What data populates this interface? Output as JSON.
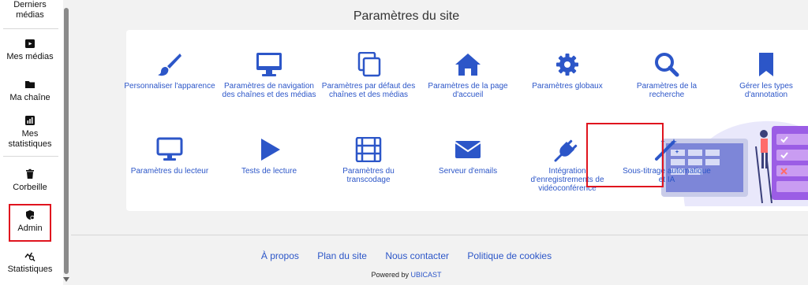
{
  "sidebar": {
    "items": [
      {
        "label": "Derniers médias",
        "icon": "clock-icon"
      },
      {
        "label": "Mes médias",
        "icon": "media-icon"
      },
      {
        "label": "Ma chaîne",
        "icon": "folder-icon"
      },
      {
        "label": "Mes statistiques",
        "icon": "stats-icon"
      },
      {
        "label": "Corbeille",
        "icon": "trash-icon"
      },
      {
        "label": "Admin",
        "icon": "admin-shield-icon"
      },
      {
        "label": "Statistiques",
        "icon": "analytics-icon"
      }
    ]
  },
  "page": {
    "title": "Paramètres du site"
  },
  "settings": {
    "row1": [
      {
        "label": "Personnaliser l'apparence",
        "icon": "paintbrush-icon"
      },
      {
        "label": "Paramètres de navigation des chaînes et des médias",
        "icon": "monitor-icon"
      },
      {
        "label": "Paramètres par défaut des chaînes et des médias",
        "icon": "copy-icon"
      },
      {
        "label": "Paramètres de la page d'accueil",
        "icon": "home-icon"
      },
      {
        "label": "Paramètres globaux",
        "icon": "gear-icon"
      },
      {
        "label": "Paramètres de la recherche",
        "icon": "search-icon"
      },
      {
        "label": "Gérer les types d'annotation",
        "icon": "bookmark-icon"
      }
    ],
    "row2": [
      {
        "label": "Paramètres du lecteur",
        "icon": "display-icon"
      },
      {
        "label": "Tests de lecture",
        "icon": "play-icon"
      },
      {
        "label": "Paramètres du transcodage",
        "icon": "film-icon"
      },
      {
        "label": "Serveur d'emails",
        "icon": "envelope-icon"
      },
      {
        "label": "Intégration d'enregistrements de vidéoconférence",
        "icon": "plug-icon"
      },
      {
        "label": "Sous-titrage automatique et IA",
        "icon": "magic-wand-icon"
      }
    ]
  },
  "footer": {
    "links": [
      "À propos",
      "Plan du site",
      "Nous contacter",
      "Politique de cookies"
    ],
    "powered_prefix": "Powered by",
    "powered_brand": "UBICAST"
  },
  "colors": {
    "accent": "#2c56c8",
    "highlight": "#e0141e"
  }
}
